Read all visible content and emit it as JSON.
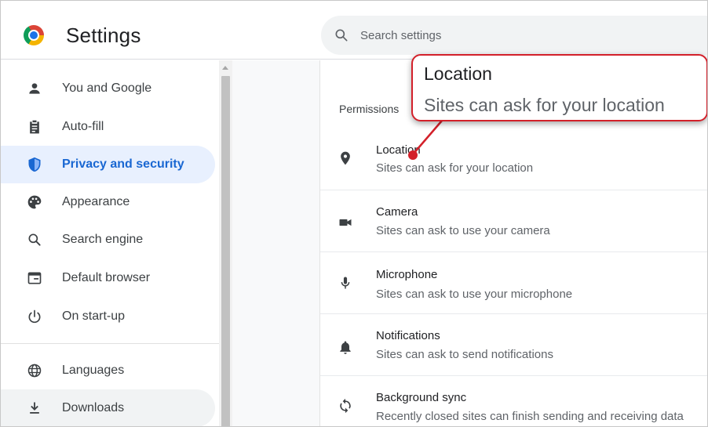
{
  "app": {
    "title": "Settings"
  },
  "search": {
    "placeholder": "Search settings",
    "value": ""
  },
  "sidebar": {
    "items": [
      {
        "label": "You and Google",
        "icon": "person-icon",
        "state": "normal"
      },
      {
        "label": "Auto-fill",
        "icon": "clipboard-icon",
        "state": "normal"
      },
      {
        "label": "Privacy and security",
        "icon": "shield-icon",
        "state": "active"
      },
      {
        "label": "Appearance",
        "icon": "palette-icon",
        "state": "normal"
      },
      {
        "label": "Search engine",
        "icon": "search-icon",
        "state": "normal"
      },
      {
        "label": "Default browser",
        "icon": "browser-window-icon",
        "state": "normal"
      },
      {
        "label": "On start-up",
        "icon": "power-icon",
        "state": "normal"
      },
      {
        "label": "Languages",
        "icon": "globe-icon",
        "state": "normal"
      },
      {
        "label": "Downloads",
        "icon": "download-icon",
        "state": "hover"
      }
    ]
  },
  "main": {
    "section_heading": "Permissions",
    "permissions": [
      {
        "title": "Location",
        "description": "Sites can ask for your location",
        "icon": "location-pin-icon"
      },
      {
        "title": "Camera",
        "description": "Sites can ask to use your camera",
        "icon": "camera-icon"
      },
      {
        "title": "Microphone",
        "description": "Sites can ask to use your microphone",
        "icon": "microphone-icon"
      },
      {
        "title": "Notifications",
        "description": "Sites can ask to send notifications",
        "icon": "bell-icon"
      },
      {
        "title": "Background sync",
        "description": "Recently closed sites can finish sending and receiving data",
        "icon": "sync-icon"
      }
    ]
  },
  "callout": {
    "title": "Location",
    "description": "Sites can ask for your location"
  },
  "colors": {
    "accent": "#1a73e8",
    "active_text": "#1967d2",
    "active_bg": "#e8f0fe",
    "callout_red": "#d3202a",
    "icon_gray": "#3c4043"
  }
}
